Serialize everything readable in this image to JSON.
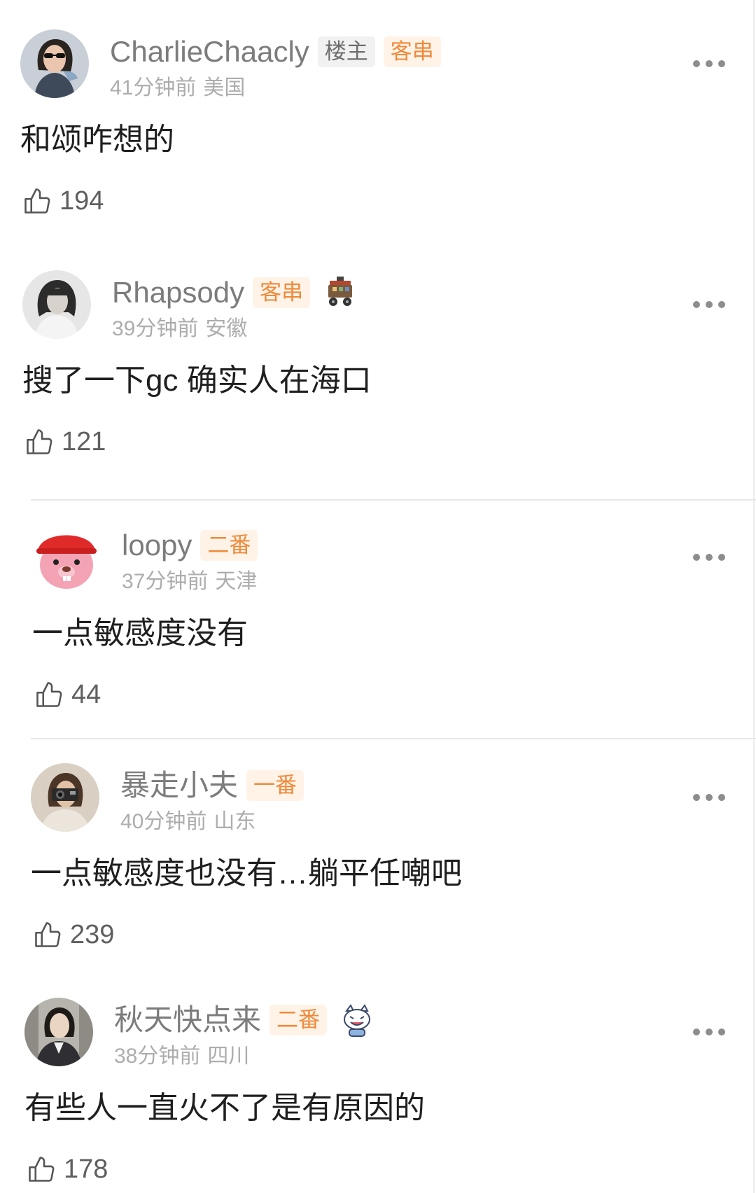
{
  "theme": {
    "badge_role_text": "#ef8a3a",
    "badge_role_bg": "#fff3e8",
    "badge_owner_text": "#6d6d6d",
    "badge_owner_bg": "#f1f1f1",
    "name_color": "#7c7c7c",
    "meta_color": "#adadad",
    "content_color": "#1f1f1f"
  },
  "comments": [
    {
      "name": "CharlieChaacly",
      "badges": [
        {
          "label": "楼主",
          "type": "owner"
        },
        {
          "label": "客串",
          "type": "role"
        }
      ],
      "time": "41分钟前",
      "location": "美国",
      "text": "和颂咋想的",
      "likes": "194",
      "more_icon": "more-dots-icon",
      "like_icon": "thumbs-up-icon"
    },
    {
      "name": "Rhapsody",
      "badges": [
        {
          "label": "客串",
          "type": "role"
        }
      ],
      "sticker": "cart-sticker-icon",
      "time": "39分钟前",
      "location": "安徽",
      "text": "搜了一下gc 确实人在海口",
      "likes": "121",
      "more_icon": "more-dots-icon",
      "like_icon": "thumbs-up-icon"
    },
    {
      "name": "loopy",
      "badges": [
        {
          "label": "二番",
          "type": "role"
        }
      ],
      "time": "37分钟前",
      "location": "天津",
      "text": "一点敏感度没有",
      "likes": "44",
      "more_icon": "more-dots-icon",
      "like_icon": "thumbs-up-icon"
    },
    {
      "name": "暴走小夫",
      "badges": [
        {
          "label": "一番",
          "type": "role"
        }
      ],
      "time": "40分钟前",
      "location": "山东",
      "text": "一点敏感度也没有…躺平任嘲吧",
      "likes": "239",
      "more_icon": "more-dots-icon",
      "like_icon": "thumbs-up-icon"
    },
    {
      "name": "秋天快点来",
      "badges": [
        {
          "label": "二番",
          "type": "role"
        }
      ],
      "sticker": "cat-sticker-icon",
      "time": "38分钟前",
      "location": "四川",
      "text": "有些人一直火不了是有原因的",
      "likes": "178",
      "more_icon": "more-dots-icon",
      "like_icon": "thumbs-up-icon"
    }
  ]
}
